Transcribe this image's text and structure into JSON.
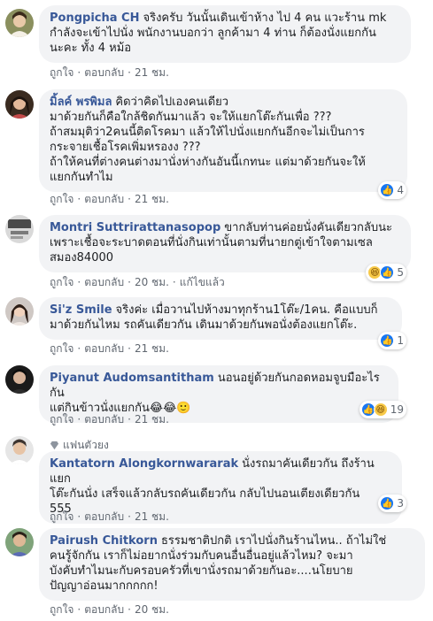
{
  "comments": [
    {
      "author": "Pongpicha CH",
      "text": "จริงครับ วันนั้นเดินเข้าห้าง ไป 4 คน แวะร้าน mk\nกำลังจะเข้าไปนั่ง พนักงานบอกว่า ลูกค้ามา 4 ท่าน ก็ต้องนั่งแยกกัน\nนะคะ ทั้ง 4 หม้อ",
      "like": "ถูกใจ",
      "reply": "ตอบกลับ",
      "time": "21 ชม.",
      "reactions": null
    },
    {
      "author": "มิ้ลค์ พรพิมล",
      "text": "คิดว่าคิดไปเองคนเดียว\nมาด้วยกันก็คือใกล้ชิดกันมาแล้ว จะให้แยกโต๊ะกันเพื่อ ???\nถ้าสมมุติว่า2คนนี้ติดโรคมา แล้วให้ไปนั่งแยกกันอีกจะไม่เป็นการ\nกระจายเชื้อโรคเพิ่มหรองง ???\nถ้าให้คนที่ต่างคนต่างมานั่งห่างกันอันนี้เกทนะ แต่มาด้วยกันจะให้\nแยกกันทำไม",
      "like": "ถูกใจ",
      "reply": "ตอบกลับ",
      "time": "21 ชม.",
      "reactions": {
        "types": [
          "like"
        ],
        "count": "4"
      }
    },
    {
      "author": "Montri Suttrirattanasopop",
      "text": "ขากลับท่านค่อยนั่งคันเดียวกลับนะ\nเพราะเชื้อจะระบาดตอนที่นั่งกินเท่านั้นตามที่นายกตู่เข้าใจตามเซล\nสมอง84000",
      "like": "ถูกใจ",
      "reply": "ตอบกลับ",
      "time": "20 ชม.",
      "edited": "แก้ไขแล้ว",
      "reactions": {
        "types": [
          "haha",
          "like"
        ],
        "count": "5"
      }
    },
    {
      "author": "Si'z Smile",
      "text": "จริงค่ะ เมื่อวานไปห้างมาทุกร้าน1โต๊ะ/1คน. คือแบบก็\nมาด้วยกันไหม รถคันเดียวกัน เดินมาด้วยกันพอนั่งต้องแยกโต๊ะ.",
      "like": "ถูกใจ",
      "reply": "ตอบกลับ",
      "time": "21 ชม.",
      "reactions": {
        "types": [
          "like"
        ],
        "count": "1"
      }
    },
    {
      "author": "Piyanut Audomsantitham",
      "text": "นอนอยู่ด้วยกันกอดหอมจูบมือะไรกัน\nแต่กินข้าวนั่งแยกกัน😂😂🙂",
      "like": "ถูกใจ",
      "reply": "ตอบกลับ",
      "time": "21 ชม.",
      "reactions": {
        "types": [
          "like",
          "haha"
        ],
        "count": "19"
      }
    },
    {
      "badge": "แฟนตัวยง",
      "author": "Kantatorn Alongkornwararak",
      "text": "นั่งรถมาคันเดียวกัน ถึงร้านแยก\nโต๊ะกันนั่ง เสร็จแล้วกลับรถคันเดียวกัน กลับไปนอนเตียงเดียวกัน\n555",
      "like": "ถูกใจ",
      "reply": "ตอบกลับ",
      "time": "21 ชม.",
      "reactions": {
        "types": [
          "like"
        ],
        "count": "3"
      }
    },
    {
      "author": "Pairush Chitkorn",
      "text": "ธรรมชาติปกติ เราไปนั่งกินร้านไหน.. ถ้าไม่ใช่\nคนรู้จักกัน เราก็ไม่อยากนั่งร่วมกับคนอื่นอื่นอยู่แล้วไหม? จะมา\nบังคับทำไมนะกับครอบครัวที่เขานั่งรถมาด้วยกันอะ....นโยบาย\nปัญญาอ่อนมากกกกก!",
      "like": "ถูกใจ",
      "reply": "ตอบกลับ",
      "time": "20 ชม.",
      "reactions": null
    }
  ],
  "colors": {
    "author": "#385898",
    "bubble": "#f2f3f5",
    "meta": "#606770",
    "like": "#1877f2",
    "haha": "#f7c948"
  }
}
